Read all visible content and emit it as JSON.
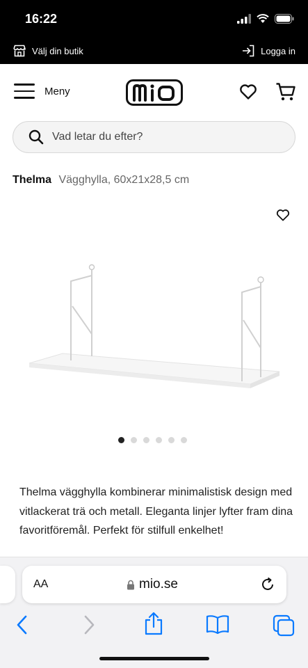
{
  "status": {
    "time": "16:22"
  },
  "topbar": {
    "store_label": "Välj din butik",
    "login_label": "Logga in"
  },
  "header": {
    "menu_label": "Meny",
    "logo_text": "mio"
  },
  "search": {
    "placeholder": "Vad letar du efter?"
  },
  "product": {
    "name": "Thelma",
    "subtitle": "Vägghylla, 60x21x28,5 cm",
    "image_count": 6,
    "active_image": 1,
    "description": "Thelma vägghylla kombinerar minimalistisk design med vitlackerat trä och metall. Eleganta linjer lyfter fram dina favoritföremål. Perfekt för stilfull enkelhet!"
  },
  "browser": {
    "aa_label": "AA",
    "url": "mio.se"
  },
  "colors": {
    "accent": "#000000",
    "safari_blue": "#0a7aff"
  }
}
